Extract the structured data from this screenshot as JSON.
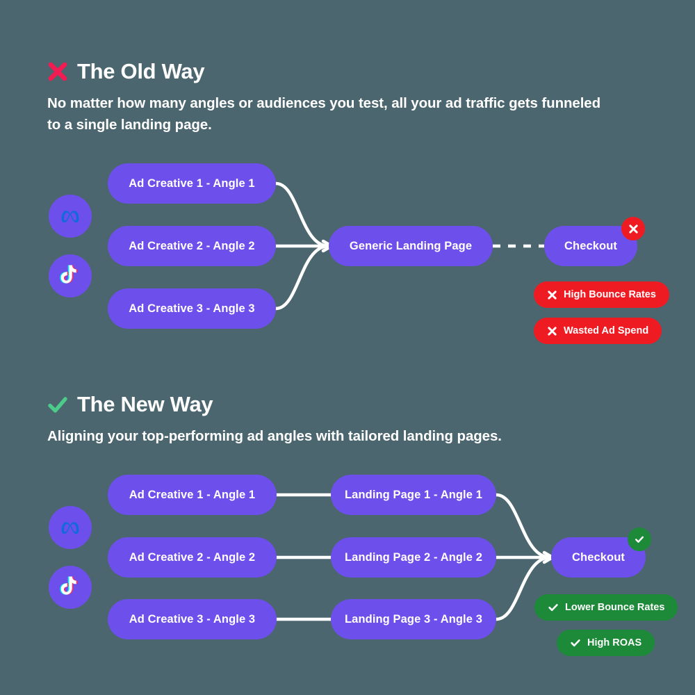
{
  "canvas": {
    "background": "#4c666f",
    "node_color": "#6d4fec",
    "bad_color": "#ef1b23",
    "good_color": "#1c8a38",
    "line_color": "#ffffff"
  },
  "sections": {
    "old": {
      "icon": "x-mark-icon",
      "title": "The Old Way",
      "subtitle": "No matter how many angles or audiences you test, all your ad traffic gets funneled to a single landing page.",
      "channels": [
        "meta-icon",
        "tiktok-icon"
      ],
      "creatives": [
        "Ad Creative 1 -  Angle 1",
        "Ad Creative 2 -  Angle 2",
        "Ad Creative 3 -  Angle 3"
      ],
      "landing": "Generic Landing Page",
      "checkout": "Checkout",
      "checkout_badge": "x-mark-icon",
      "chips": [
        {
          "icon": "x-mark-icon",
          "label": "High Bounce Rates"
        },
        {
          "icon": "x-mark-icon",
          "label": "Wasted Ad Spend"
        }
      ]
    },
    "new": {
      "icon": "check-mark-icon",
      "title": "The New Way",
      "subtitle": "Aligning your top-performing ad angles with tailored landing pages.",
      "channels": [
        "meta-icon",
        "tiktok-icon"
      ],
      "creatives": [
        "Ad Creative 1 -  Angle 1",
        "Ad Creative 2 -  Angle 2",
        "Ad Creative 3 -  Angle 3"
      ],
      "landings": [
        "Landing Page 1 -  Angle 1",
        "Landing Page 2 -  Angle 2",
        "Landing Page 3 -  Angle 3"
      ],
      "checkout": "Checkout",
      "checkout_badge": "check-mark-icon",
      "chips": [
        {
          "icon": "check-mark-icon",
          "label": "Lower Bounce Rates"
        },
        {
          "icon": "check-mark-icon",
          "label": "High ROAS"
        }
      ]
    }
  }
}
